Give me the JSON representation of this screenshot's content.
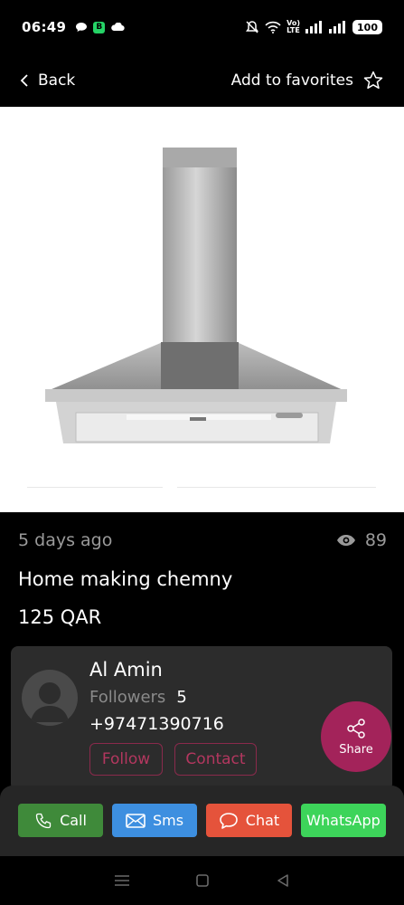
{
  "status_bar": {
    "time": "06:49",
    "battery": "100",
    "network_label_top": "Vo)",
    "network_label_bottom": "LTE",
    "chip_label": "B"
  },
  "header": {
    "back_label": "Back",
    "favorites_label": "Add to favorites"
  },
  "listing": {
    "posted": "5 days ago",
    "views": "89",
    "title": "Home making chemny",
    "price": "125 QAR"
  },
  "seller": {
    "name": "Al Amin",
    "followers_label": "Followers",
    "followers_count": "5",
    "phone": "+97471390716",
    "follow_label": "Follow",
    "contact_label": "Contact"
  },
  "share": {
    "label": "Share"
  },
  "actions": {
    "call": {
      "label": "Call",
      "color": "#3f8a3a"
    },
    "sms": {
      "label": "Sms",
      "color": "#3d8fe0"
    },
    "chat": {
      "label": "Chat",
      "color": "#e5533b"
    },
    "whatsapp": {
      "label": "WhatsApp",
      "color": "#3dd45a"
    }
  },
  "colors": {
    "accent": "#a3235a",
    "background": "#000000",
    "card": "#2c2c2c"
  }
}
